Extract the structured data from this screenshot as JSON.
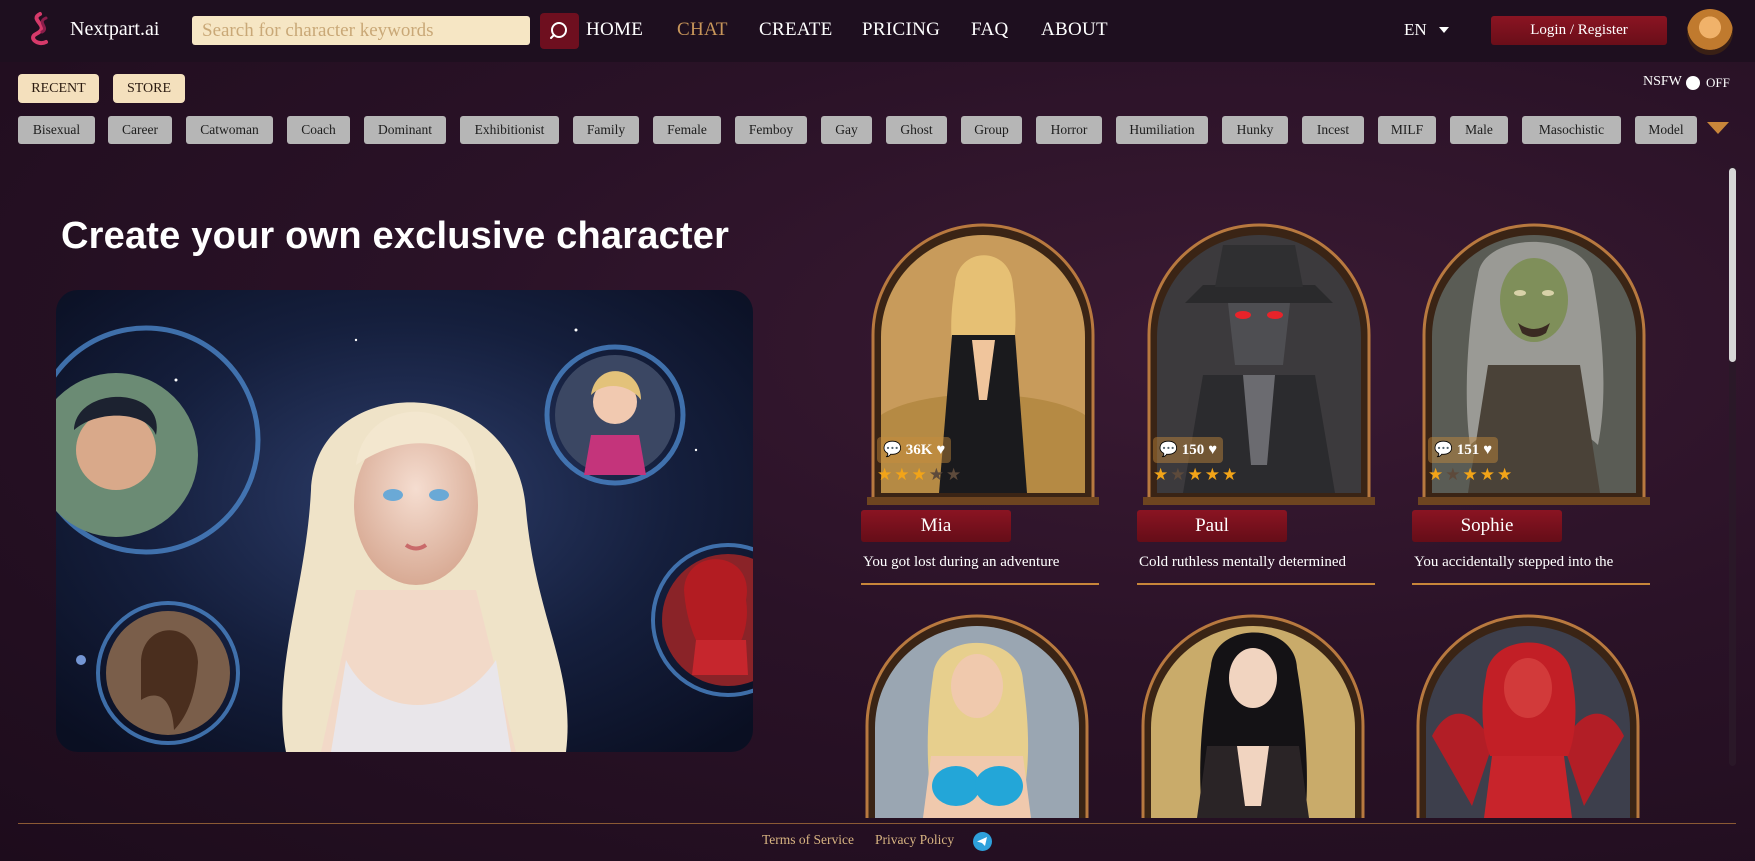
{
  "header": {
    "brand": "Nextpart.ai",
    "search_placeholder": "Search for character keywords",
    "nav": [
      "HOME",
      "CHAT",
      "CREATE",
      "PRICING",
      "FAQ",
      "ABOUT"
    ],
    "active_nav": "CHAT",
    "language": "EN",
    "login_label": "Login / Register",
    "accent": "#c8965a"
  },
  "filters": {
    "recent_label": "RECENT",
    "store_label": "STORE",
    "nsfw_label": "NSFW",
    "nsfw_state": "OFF",
    "tags": [
      "Bisexual",
      "Career",
      "Catwoman",
      "Coach",
      "Dominant",
      "Exhibitionist",
      "Family",
      "Female",
      "Femboy",
      "Gay",
      "Ghost",
      "Group",
      "Horror",
      "Humiliation",
      "Hunky",
      "Incest",
      "MILF",
      "Male",
      "Masochistic",
      "Model"
    ]
  },
  "hero": {
    "title": "Create your own exclusive character"
  },
  "characters": [
    {
      "name": "Mia",
      "chats": "36K",
      "rating": 3,
      "description": "You got lost during an adventure"
    },
    {
      "name": "Paul",
      "chats": "150",
      "rating": 4,
      "description": "Cold ruthless mentally determined"
    },
    {
      "name": "Sophie",
      "chats": "151",
      "rating": 4,
      "description": "You accidentally stepped into the"
    },
    {
      "name": "",
      "chats": "",
      "rating": 0,
      "description": ""
    },
    {
      "name": "",
      "chats": "",
      "rating": 0,
      "description": ""
    },
    {
      "name": "",
      "chats": "",
      "rating": 0,
      "description": ""
    }
  ],
  "footer": {
    "terms": "Terms of Service",
    "privacy": "Privacy Policy"
  }
}
